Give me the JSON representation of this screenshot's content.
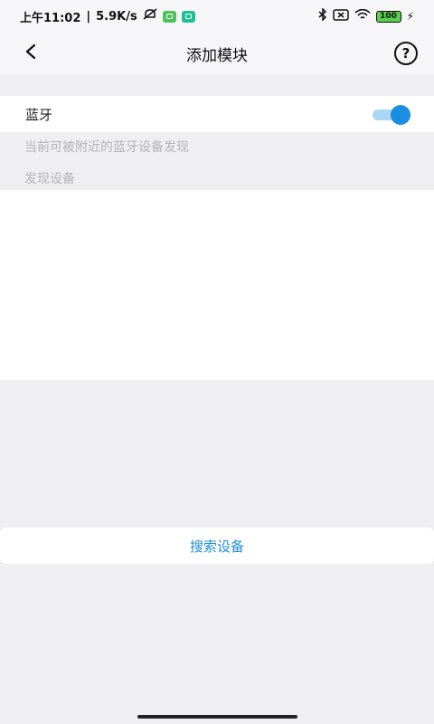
{
  "status_bar": {
    "time": "上午11:02",
    "net_speed": "5.9K/s",
    "separator": "|",
    "mute_icon": "mute-icon",
    "battery_level": "100",
    "bluetooth_icon": "bluetooth-icon",
    "wifi_icon": "wifi-icon"
  },
  "header": {
    "title": "添加模块",
    "back_icon": "back-arrow-icon",
    "help_icon": "help-icon",
    "help_glyph": "?"
  },
  "bluetooth": {
    "label": "蓝牙",
    "enabled": true,
    "discoverable_hint": "当前可被附近的蓝牙设备发现",
    "devices_header": "发现设备"
  },
  "devices": [],
  "actions": {
    "search_label": "搜索设备"
  },
  "colors": {
    "accent": "#1a8ee0",
    "toggle_track": "#a9d6f3",
    "background": "#efeff1",
    "hint_text": "#b3b3b6"
  }
}
